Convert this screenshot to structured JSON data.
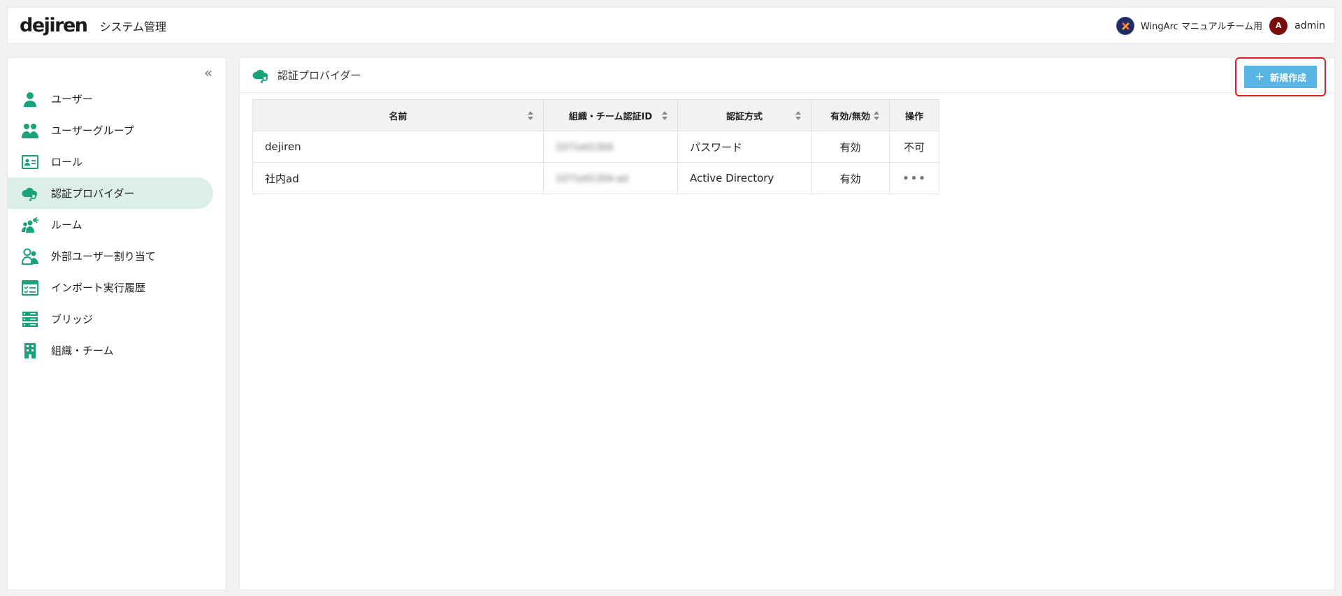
{
  "header": {
    "logo": "dejiren",
    "app_title": "システム管理",
    "org_name": "WingArc マニュアルチーム用",
    "avatar_initial": "A",
    "username": "admin"
  },
  "sidebar": {
    "collapse_icon": "«",
    "items": [
      {
        "label": "ユーザー",
        "icon": "user-icon"
      },
      {
        "label": "ユーザーグループ",
        "icon": "user-group-icon"
      },
      {
        "label": "ロール",
        "icon": "id-card-icon"
      },
      {
        "label": "認証プロバイダー",
        "icon": "cloud-key-icon",
        "active": true
      },
      {
        "label": "ルーム",
        "icon": "room-icon"
      },
      {
        "label": "外部ユーザー割り当て",
        "icon": "external-user-icon"
      },
      {
        "label": "インポート実行履歴",
        "icon": "import-history-icon"
      },
      {
        "label": "ブリッジ",
        "icon": "server-icon"
      },
      {
        "label": "組織・チーム",
        "icon": "building-icon"
      }
    ]
  },
  "main": {
    "title": "認証プロバイダー",
    "new_button": {
      "plus": "+",
      "label": "新規作成"
    },
    "table": {
      "columns": [
        "名前",
        "組織・チーム認証ID",
        "認証方式",
        "有効/無効",
        "操作"
      ],
      "rows": [
        {
          "name": "dejiren",
          "auth_id": "1071e01304",
          "method": "パスワード",
          "status": "有効",
          "operation": "不可"
        },
        {
          "name": "社内ad",
          "auth_id": "1071e01304-ad",
          "method": "Active Directory",
          "status": "有効",
          "operation": "•••"
        }
      ]
    }
  },
  "colors": {
    "accent": "#1aa37a",
    "active_bg": "#dcefe7",
    "button": "#58b4e3",
    "highlight": "#e32020"
  }
}
